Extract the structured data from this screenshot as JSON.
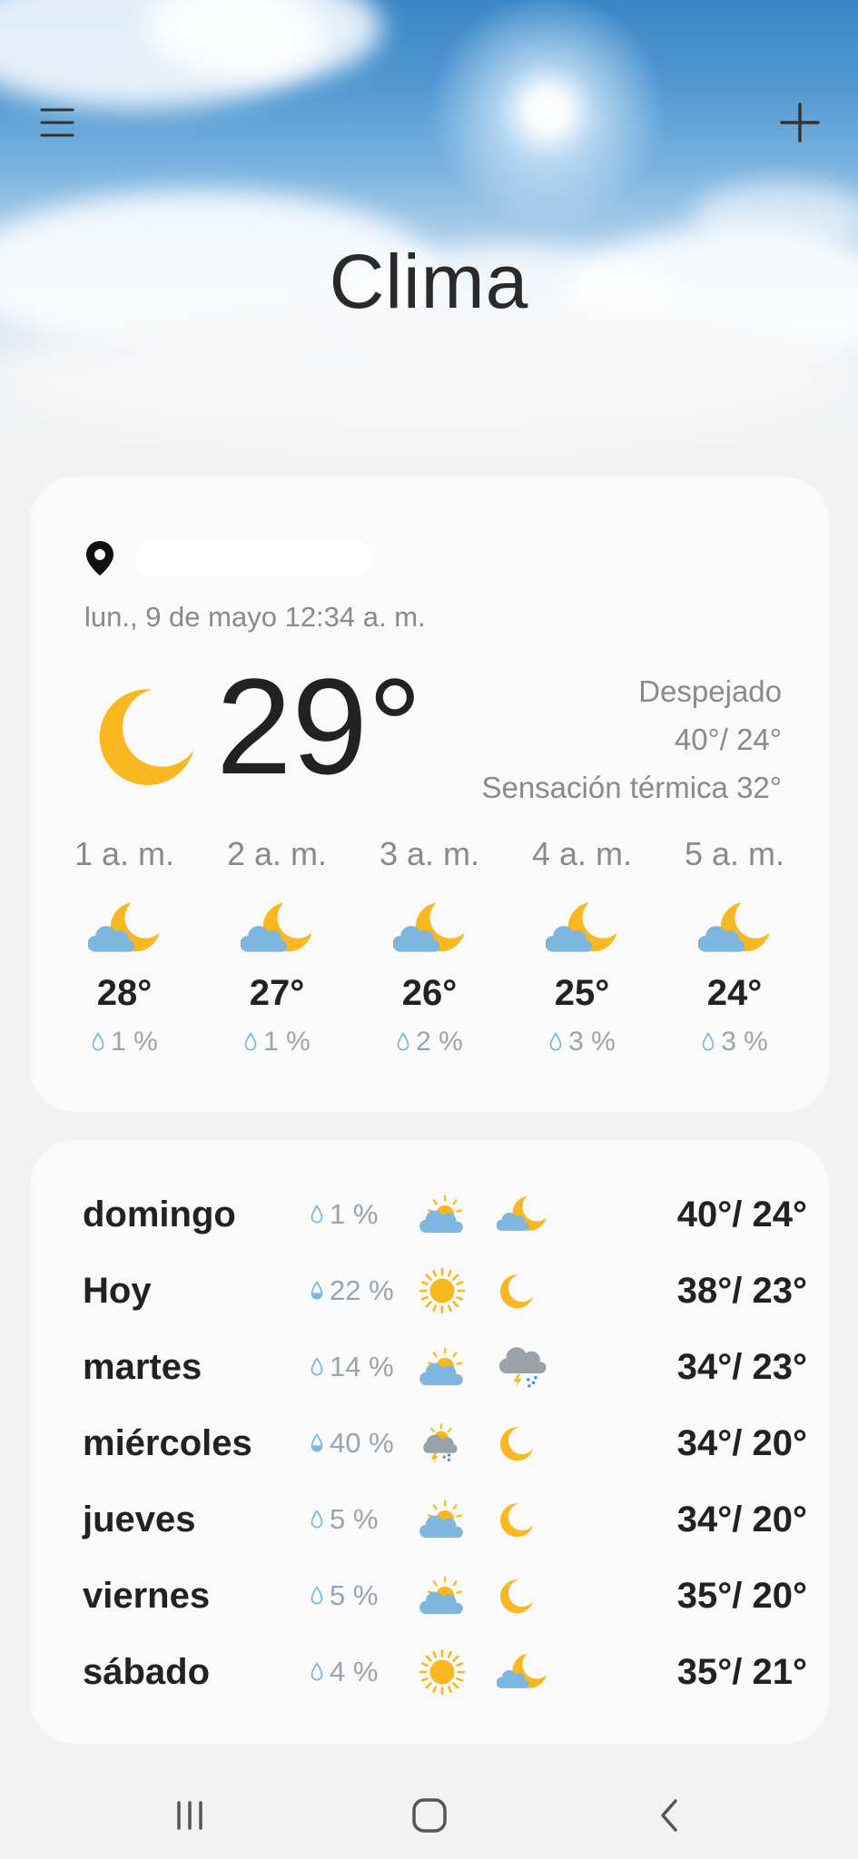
{
  "app": {
    "title": "Clima",
    "menu_icon": "hamburger-menu-icon",
    "add_icon": "plus-icon"
  },
  "current": {
    "location_icon": "location-pin-icon",
    "location_name": "",
    "datetime": "lun., 9 de mayo 12:34 a. m.",
    "condition_icon": "moon-icon",
    "temperature": "29°",
    "condition": "Despejado",
    "high_low": "40°/ 24°",
    "feels_like": "Sensación térmica 32°"
  },
  "hourly": [
    {
      "time": "1 a. m.",
      "icon": "moon-cloud-icon",
      "temp": "28°",
      "precip": "1 %"
    },
    {
      "time": "2 a. m.",
      "icon": "moon-cloud-icon",
      "temp": "27°",
      "precip": "1 %"
    },
    {
      "time": "3 a. m.",
      "icon": "moon-cloud-icon",
      "temp": "26°",
      "precip": "2 %"
    },
    {
      "time": "4 a. m.",
      "icon": "moon-cloud-icon",
      "temp": "25°",
      "precip": "3 %"
    },
    {
      "time": "5 a. m.",
      "icon": "moon-cloud-icon",
      "temp": "24°",
      "precip": "3 %"
    }
  ],
  "daily": [
    {
      "day": "domingo",
      "precip": "1 %",
      "day_icon": "sun-cloud-icon",
      "night_icon": "moon-cloud-icon",
      "temps": "40°/ 24°"
    },
    {
      "day": "Hoy",
      "precip": "22 %",
      "day_icon": "sun-icon",
      "night_icon": "moon-icon",
      "temps": "38°/ 23°"
    },
    {
      "day": "martes",
      "precip": "14 %",
      "day_icon": "sun-cloud-icon",
      "night_icon": "thunderstorm-icon",
      "temps": "34°/ 23°"
    },
    {
      "day": "miércoles",
      "precip": "40 %",
      "day_icon": "sun-storm-icon",
      "night_icon": "moon-icon",
      "temps": "34°/ 20°"
    },
    {
      "day": "jueves",
      "precip": "5 %",
      "day_icon": "sun-cloud-icon",
      "night_icon": "moon-icon",
      "temps": "34°/ 20°"
    },
    {
      "day": "viernes",
      "precip": "5 %",
      "day_icon": "sun-cloud-icon",
      "night_icon": "moon-icon",
      "temps": "35°/ 20°"
    },
    {
      "day": "sábado",
      "precip": "4 %",
      "day_icon": "sun-icon",
      "night_icon": "moon-cloud-icon",
      "temps": "35°/ 21°"
    }
  ],
  "colors": {
    "accent_yellow": "#f9b81f",
    "cloud_blue": "#7eb6e0",
    "text_dark": "#222222",
    "text_muted": "#8a8a8a"
  },
  "nav": {
    "recent_icon": "recent-apps-icon",
    "home_icon": "home-icon",
    "back_icon": "back-icon"
  }
}
